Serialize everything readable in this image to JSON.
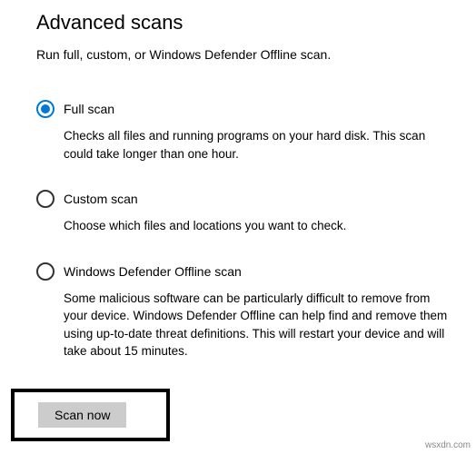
{
  "header": {
    "title": "Advanced scans",
    "subtitle": "Run full, custom, or Windows Defender Offline scan."
  },
  "options": {
    "full": {
      "label": "Full scan",
      "desc": "Checks all files and running programs on your hard disk. This scan could take longer than one hour."
    },
    "custom": {
      "label": "Custom scan",
      "desc": "Choose which files and locations you want to check."
    },
    "offline": {
      "label": "Windows Defender Offline scan",
      "desc": "Some malicious software can be particularly difficult to remove from your device. Windows Defender Offline can help find and remove them using up-to-date threat definitions. This will restart your device and will take about 15 minutes."
    }
  },
  "actions": {
    "scan_now": "Scan now"
  },
  "watermark": "wsxdn.com"
}
